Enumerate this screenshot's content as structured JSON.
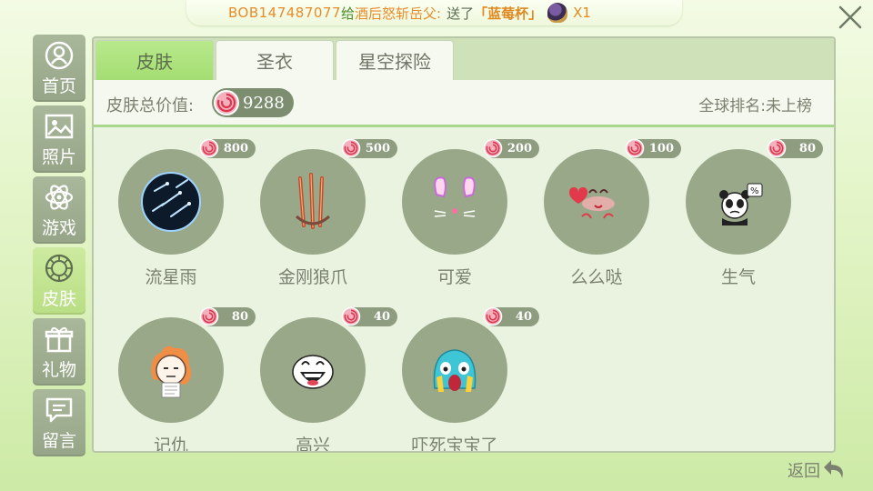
{
  "banner": {
    "user": "BOB147487077",
    "verb": "给",
    "target": "酒后怒斩岳父:",
    "sent": "送了",
    "gift": "「蓝莓杯」",
    "multiplier": "X1"
  },
  "nav": {
    "items": [
      {
        "label": "首页",
        "icon": "home-icon"
      },
      {
        "label": "照片",
        "icon": "photo-icon"
      },
      {
        "label": "游戏",
        "icon": "atom-icon"
      },
      {
        "label": "皮肤",
        "icon": "skin-icon",
        "active": true
      },
      {
        "label": "礼物",
        "icon": "gift-icon"
      },
      {
        "label": "留言",
        "icon": "message-icon"
      }
    ]
  },
  "tabs": [
    {
      "label": "皮肤",
      "active": true
    },
    {
      "label": "圣衣"
    },
    {
      "label": "星空探险"
    }
  ],
  "summary": {
    "label": "皮肤总价值:",
    "value": "9288",
    "rank": "全球排名:未上榜"
  },
  "skins": [
    {
      "name": "流星雨",
      "price": "800"
    },
    {
      "name": "金刚狼爪",
      "price": "500"
    },
    {
      "name": "可爱",
      "price": "200"
    },
    {
      "name": "么么哒",
      "price": "100"
    },
    {
      "name": "生气",
      "price": "80"
    },
    {
      "name": "记仇",
      "price": "80"
    },
    {
      "name": "高兴",
      "price": "40"
    },
    {
      "name": "吓死宝宝了",
      "price": "40"
    }
  ],
  "footer": {
    "back_label": "返回"
  },
  "colors": {
    "accent_green": "#a4de72",
    "nav_inactive": "#96a587",
    "price_orange": "#e08a22",
    "candy_red": "#e8556a"
  }
}
